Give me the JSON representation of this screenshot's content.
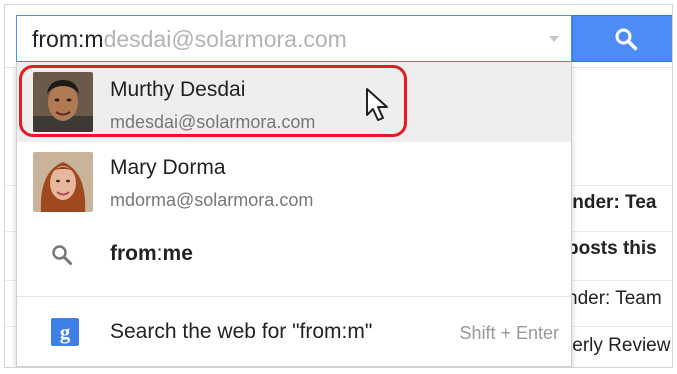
{
  "search": {
    "typed": "from:m",
    "completion": "desdai@solarmora.com"
  },
  "suggestions": [
    {
      "name": "Murthy Desdai",
      "email": "mdesdai@solarmora.com",
      "highlighted": true
    },
    {
      "name": "Mary Dorma",
      "email": "mdorma@solarmora.com",
      "highlighted": false
    }
  ],
  "query_suggestion": {
    "bold_a": "from",
    "sep": ":",
    "bold_b": "me"
  },
  "web_search": {
    "icon_letter": "g",
    "label": "Search the web for \"from:m\"",
    "shortcut": "Shift + Enter"
  },
  "background_rows": [
    {
      "text": "inder: Tea",
      "bold": true
    },
    {
      "text": "posts this",
      "bold": true
    },
    {
      "text": "nder: Team",
      "bold": false
    },
    {
      "text": "terly Review",
      "bold": false
    }
  ],
  "colors": {
    "accent": "#4d8cf4",
    "highlight_ring": "#e31b23"
  },
  "icons": [
    "search-icon",
    "chevron-down-icon",
    "google-g-icon",
    "mouse-pointer-icon"
  ]
}
